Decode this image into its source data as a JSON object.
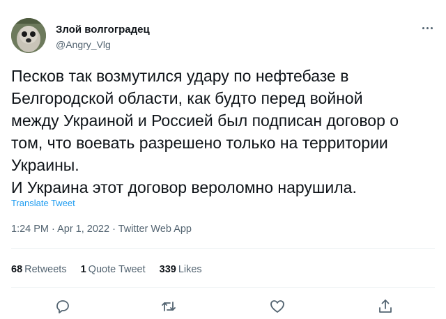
{
  "tweet": {
    "display_name": "Злой волгоградец",
    "handle": "@Angry_Vlg",
    "text": "Песков так возмутился удару по нефтебазе в\nБелгородской области, как будто перед войной\nмежду Украиной и Россией был подписан договор о\nтом, что воевать разрешено только на территории\nУкраины.\nИ Украина этот договор вероломно нарушила.",
    "translate_label": "Translate Tweet",
    "timestamp": "1:24 PM · Apr 1, 2022 · Twitter Web App"
  },
  "stats": {
    "retweets_count": "68",
    "retweets_label": "Retweets",
    "quotes_count": "1",
    "quotes_label": "Quote Tweet",
    "likes_count": "339",
    "likes_label": "Likes"
  },
  "icons": {
    "more": "more-horizontal-icon",
    "reply": "reply-icon",
    "retweet": "retweet-icon",
    "like": "heart-icon",
    "share": "share-icon"
  },
  "colors": {
    "link": "#1d9bf0",
    "secondary_text": "#536471",
    "primary_text": "#0f1419",
    "divider": "#eff3f4"
  }
}
